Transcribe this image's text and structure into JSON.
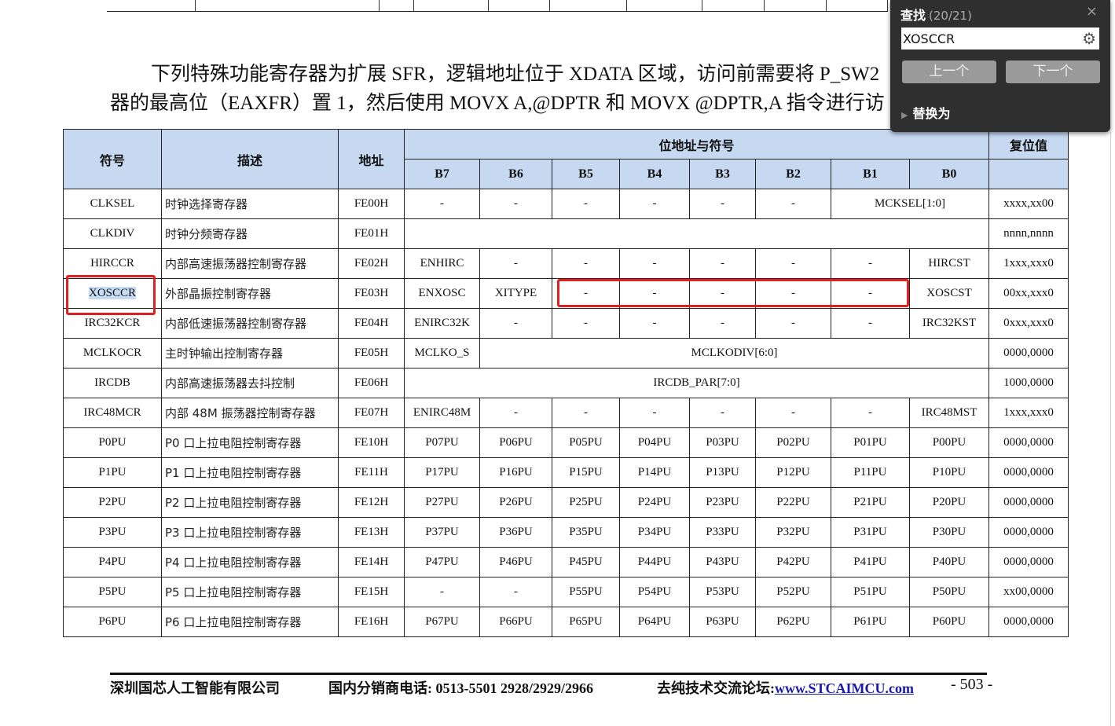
{
  "intro": {
    "line1": "下列特殊功能寄存器为扩展 SFR，逻辑地址位于 XDATA 区域，访问前需要将 P_SW2（",
    "line2": "器的最高位（EAXFR）置 1，然后使用 MOVX A,@DPTR 和 MOVX @DPTR,A 指令进行访"
  },
  "table": {
    "headers": {
      "symbol": "符号",
      "desc": "描述",
      "addr": "地址",
      "bits_group": "位地址与符号",
      "reset": "复位值",
      "bits": [
        "B7",
        "B6",
        "B5",
        "B4",
        "B3",
        "B2",
        "B1",
        "B0"
      ]
    },
    "rows": [
      {
        "symbol": "CLKSEL",
        "desc": "时钟选择寄存器",
        "addr": "FE00H",
        "bits": [
          {
            "t": "-"
          },
          {
            "t": "-"
          },
          {
            "t": "-"
          },
          {
            "t": "-"
          },
          {
            "t": "-"
          },
          {
            "t": "-"
          },
          {
            "t": "MCKSEL[1:0]",
            "span": 2
          }
        ],
        "reset": "xxxx,xx00"
      },
      {
        "symbol": "CLKDIV",
        "desc": "时钟分频寄存器",
        "addr": "FE01H",
        "bits": [
          {
            "t": "",
            "span": 8
          }
        ],
        "reset": "nnnn,nnnn"
      },
      {
        "symbol": "HIRCCR",
        "desc": "内部高速振荡器控制寄存器",
        "addr": "FE02H",
        "bits": [
          {
            "t": "ENHIRC"
          },
          {
            "t": "-"
          },
          {
            "t": "-"
          },
          {
            "t": "-"
          },
          {
            "t": "-"
          },
          {
            "t": "-"
          },
          {
            "t": "-"
          },
          {
            "t": "HIRCST"
          }
        ],
        "reset": "1xxx,xxx0"
      },
      {
        "symbol": "XOSCCR",
        "desc": "外部晶振控制寄存器",
        "addr": "FE03H",
        "bits": [
          {
            "t": "ENXOSC"
          },
          {
            "t": "XITYPE"
          },
          {
            "t": "-"
          },
          {
            "t": "-"
          },
          {
            "t": "-"
          },
          {
            "t": "-"
          },
          {
            "t": "-"
          },
          {
            "t": "XOSCST"
          }
        ],
        "reset": "00xx,xxx0",
        "highlight": true
      },
      {
        "symbol": "IRC32KCR",
        "desc": "内部低速振荡器控制寄存器",
        "addr": "FE04H",
        "bits": [
          {
            "t": "ENIRC32K"
          },
          {
            "t": "-"
          },
          {
            "t": "-"
          },
          {
            "t": "-"
          },
          {
            "t": "-"
          },
          {
            "t": "-"
          },
          {
            "t": "-"
          },
          {
            "t": "IRC32KST"
          }
        ],
        "reset": "0xxx,xxx0"
      },
      {
        "symbol": "MCLKOCR",
        "desc": "主时钟输出控制寄存器",
        "addr": "FE05H",
        "bits": [
          {
            "t": "MCLKO_S"
          },
          {
            "t": "MCLKODIV[6:0]",
            "span": 7
          }
        ],
        "reset": "0000,0000"
      },
      {
        "symbol": "IRCDB",
        "desc": "内部高速振荡器去抖控制",
        "addr": "FE06H",
        "bits": [
          {
            "t": "IRCDB_PAR[7:0]",
            "span": 8
          }
        ],
        "reset": "1000,0000"
      },
      {
        "symbol": "IRC48MCR",
        "desc": "内部 48M 振荡器控制寄存器",
        "addr": "FE07H",
        "bits": [
          {
            "t": "ENIRC48M"
          },
          {
            "t": "-"
          },
          {
            "t": "-"
          },
          {
            "t": "-"
          },
          {
            "t": "-"
          },
          {
            "t": "-"
          },
          {
            "t": "-"
          },
          {
            "t": "IRC48MST"
          }
        ],
        "reset": "1xxx,xxx0"
      },
      {
        "symbol": "P0PU",
        "desc": "P0 口上拉电阻控制寄存器",
        "addr": "FE10H",
        "bits": [
          {
            "t": "P07PU"
          },
          {
            "t": "P06PU"
          },
          {
            "t": "P05PU"
          },
          {
            "t": "P04PU"
          },
          {
            "t": "P03PU"
          },
          {
            "t": "P02PU"
          },
          {
            "t": "P01PU"
          },
          {
            "t": "P00PU"
          }
        ],
        "reset": "0000,0000"
      },
      {
        "symbol": "P1PU",
        "desc": "P1 口上拉电阻控制寄存器",
        "addr": "FE11H",
        "bits": [
          {
            "t": "P17PU"
          },
          {
            "t": "P16PU"
          },
          {
            "t": "P15PU"
          },
          {
            "t": "P14PU"
          },
          {
            "t": "P13PU"
          },
          {
            "t": "P12PU"
          },
          {
            "t": "P11PU"
          },
          {
            "t": "P10PU"
          }
        ],
        "reset": "0000,0000"
      },
      {
        "symbol": "P2PU",
        "desc": "P2 口上拉电阻控制寄存器",
        "addr": "FE12H",
        "bits": [
          {
            "t": "P27PU"
          },
          {
            "t": "P26PU"
          },
          {
            "t": "P25PU"
          },
          {
            "t": "P24PU"
          },
          {
            "t": "P23PU"
          },
          {
            "t": "P22PU"
          },
          {
            "t": "P21PU"
          },
          {
            "t": "P20PU"
          }
        ],
        "reset": "0000,0000"
      },
      {
        "symbol": "P3PU",
        "desc": "P3 口上拉电阻控制寄存器",
        "addr": "FE13H",
        "bits": [
          {
            "t": "P37PU"
          },
          {
            "t": "P36PU"
          },
          {
            "t": "P35PU"
          },
          {
            "t": "P34PU"
          },
          {
            "t": "P33PU"
          },
          {
            "t": "P32PU"
          },
          {
            "t": "P31PU"
          },
          {
            "t": "P30PU"
          }
        ],
        "reset": "0000,0000"
      },
      {
        "symbol": "P4PU",
        "desc": "P4 口上拉电阻控制寄存器",
        "addr": "FE14H",
        "bits": [
          {
            "t": "P47PU"
          },
          {
            "t": "P46PU"
          },
          {
            "t": "P45PU"
          },
          {
            "t": "P44PU"
          },
          {
            "t": "P43PU"
          },
          {
            "t": "P42PU"
          },
          {
            "t": "P41PU"
          },
          {
            "t": "P40PU"
          }
        ],
        "reset": "0000,0000"
      },
      {
        "symbol": "P5PU",
        "desc": "P5 口上拉电阻控制寄存器",
        "addr": "FE15H",
        "bits": [
          {
            "t": "-"
          },
          {
            "t": "-"
          },
          {
            "t": "P55PU"
          },
          {
            "t": "P54PU"
          },
          {
            "t": "P53PU"
          },
          {
            "t": "P52PU"
          },
          {
            "t": "P51PU"
          },
          {
            "t": "P50PU"
          }
        ],
        "reset": "xx00,0000"
      },
      {
        "symbol": "P6PU",
        "desc": "P6 口上拉电阻控制寄存器",
        "addr": "FE16H",
        "bits": [
          {
            "t": "P67PU"
          },
          {
            "t": "P66PU"
          },
          {
            "t": "P65PU"
          },
          {
            "t": "P64PU"
          },
          {
            "t": "P63PU"
          },
          {
            "t": "P62PU"
          },
          {
            "t": "P61PU"
          },
          {
            "t": "P60PU"
          }
        ],
        "reset": "0000,0000"
      }
    ]
  },
  "footer": {
    "company": "深圳国芯人工智能有限公司",
    "phone": "国内分销商电话: 0513-5501 2928/2929/2966",
    "forum_label": "去纯技术交流论坛:",
    "forum_link": "www.STCAIMCU.com",
    "page": "- 503 -"
  },
  "find_panel": {
    "title": "查找",
    "count": "(20/21)",
    "query": "XOSCCR",
    "prev_label": "上一个",
    "next_label": "下一个",
    "replace_label": "替换为",
    "close_icon": "×",
    "settings_icon": "⚙"
  },
  "colors": {
    "header_bg": "#c6d9f1",
    "highlight_box": "#e02020",
    "panel_bg": "#2f2f2f",
    "link": "#1a1aa8"
  }
}
